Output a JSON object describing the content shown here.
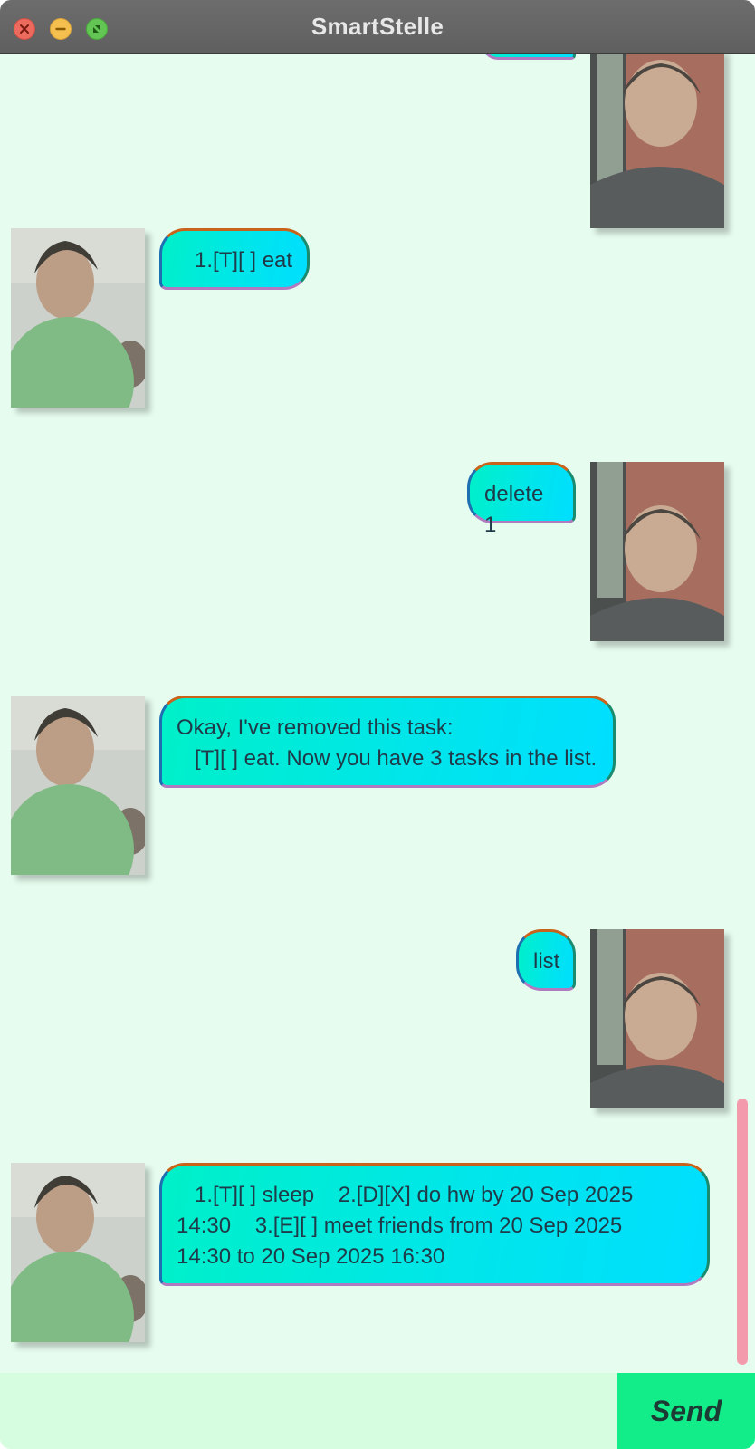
{
  "window": {
    "title": "SmartStelle"
  },
  "messages": [
    {
      "sender": "user",
      "text": ""
    },
    {
      "sender": "bot",
      "text": "   1.[T][ ] eat"
    },
    {
      "sender": "user",
      "text": "delete 1"
    },
    {
      "sender": "bot",
      "text": "Okay, I've removed this task:\n   [T][ ] eat. Now you have 3 tasks in the list."
    },
    {
      "sender": "user",
      "text": "list"
    },
    {
      "sender": "bot",
      "text": "   1.[T][ ] sleep    2.[D][X] do hw by 20 Sep 2025\n14:30    3.[E][ ] meet friends from 20 Sep 2025\n14:30 to 20 Sep 2025 16:30"
    }
  ],
  "input": {
    "value": "",
    "placeholder": ""
  },
  "send_button": {
    "label": "Send"
  },
  "colors": {
    "background": "#e6fcee",
    "bubble_start": "#00f0c8",
    "bubble_end": "#00deff",
    "send": "#12ed8a",
    "input": "#d6fde0",
    "scrollbar": "#f39aac"
  },
  "avatars": {
    "user": "user-avatar-photo",
    "bot": "bot-avatar-photo"
  }
}
